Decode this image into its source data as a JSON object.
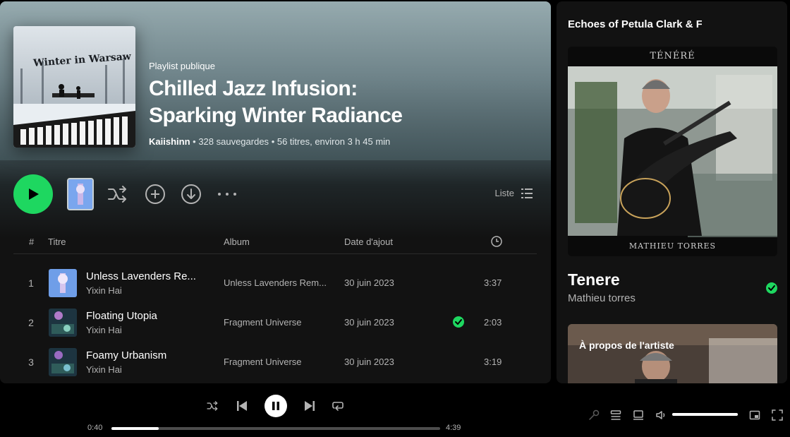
{
  "playlist": {
    "type": "Playlist publique",
    "title_line1": "Chilled Jazz Infusion:",
    "title_line2": "Sparking Winter Radiance",
    "owner": "Kaiishinn",
    "saves": "328 sauvegardes",
    "stats": "56 titres, environ 3 h 45 min",
    "cover_text": "Winter in Warsaw"
  },
  "controls": {
    "list_label": "Liste",
    "icons": [
      "play-icon",
      "shuffle-icon",
      "add-circle-icon",
      "download-icon",
      "more-icon",
      "list-icon"
    ]
  },
  "table": {
    "headers": {
      "num": "#",
      "title": "Titre",
      "album": "Album",
      "date": "Date d'ajout"
    },
    "rows": [
      {
        "num": "1",
        "title": "Unless Lavenders Re...",
        "artist": "Yixin Hai",
        "album": "Unless Lavenders Rem...",
        "date": "30 juin 2023",
        "saved": false,
        "duration": "3:37"
      },
      {
        "num": "2",
        "title": "Floating Utopia",
        "artist": "Yixin Hai",
        "album": "Fragment Universe",
        "date": "30 juin 2023",
        "saved": true,
        "duration": "2:03"
      },
      {
        "num": "3",
        "title": "Foamy Urbanism",
        "artist": "Yixin Hai",
        "album": "Fragment Universe",
        "date": "30 juin 2023",
        "saved": false,
        "duration": "3:19"
      }
    ]
  },
  "side": {
    "title": "Echoes of Petula Clark & F",
    "video_top_text": "TÉNÉRÉ",
    "video_bottom_text": "MATHIEU TORRES",
    "song": "Tenere",
    "artist": "Mathieu torres",
    "about_label": "À propos de l'artiste"
  },
  "player": {
    "elapsed": "0:40",
    "total": "4:39",
    "progress": 0.143,
    "volume": 1.0
  },
  "colors": {
    "accent": "#1ed760",
    "background": "#121212",
    "text_muted": "#b3b3b3"
  }
}
